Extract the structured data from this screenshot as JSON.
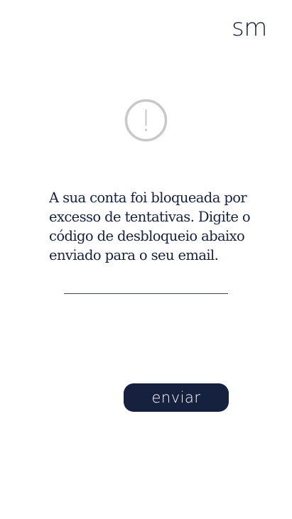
{
  "header": {
    "logo_text": "sm"
  },
  "alert": {
    "icon": "exclamation-circle-icon",
    "icon_color": "#c8c8c8"
  },
  "main": {
    "message": "A sua conta foi bloqueada por excesso de tentativas. Digite o código de desbloqueio abaixo enviado para o seu email.",
    "code_input_value": "",
    "code_input_placeholder": ""
  },
  "actions": {
    "send_label": "enviar"
  },
  "colors": {
    "brand": "#16213f",
    "background": "#ffffff"
  }
}
